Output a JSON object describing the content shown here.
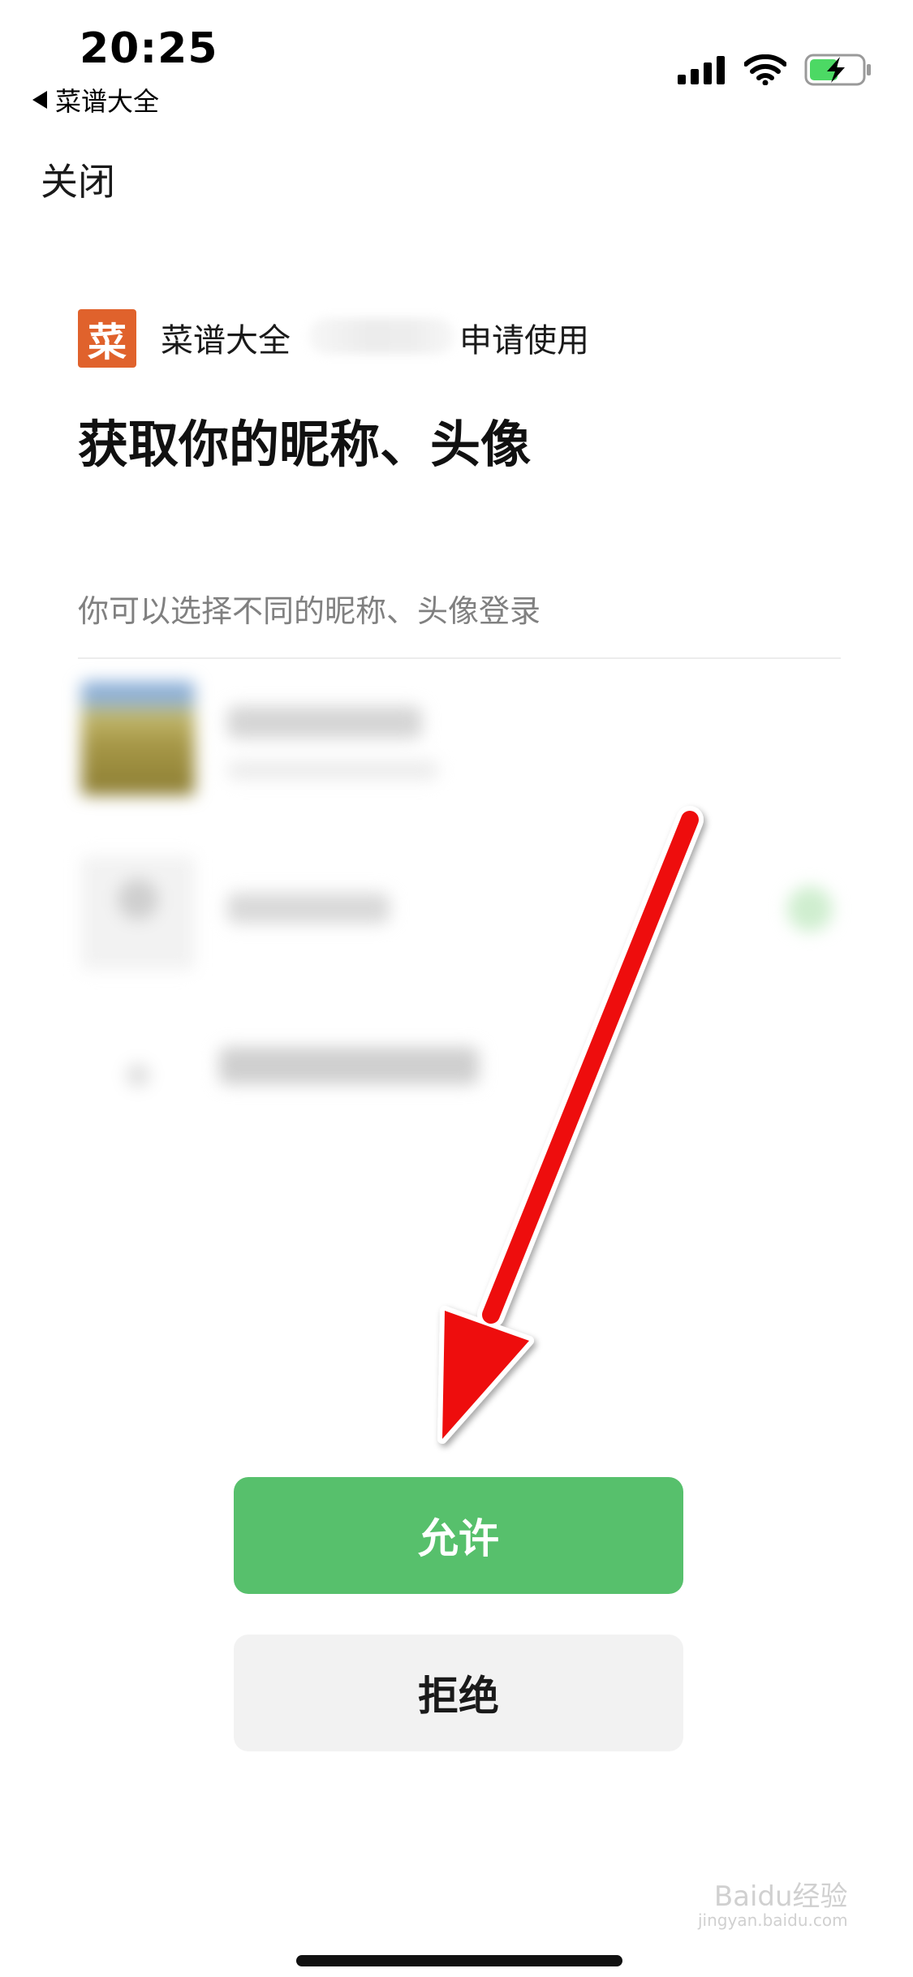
{
  "status_bar": {
    "time": "20:25",
    "back_app": "菜谱大全",
    "icons": [
      "cellular-signal-icon",
      "wifi-icon",
      "battery-charging-icon"
    ]
  },
  "nav": {
    "close_label": "关闭"
  },
  "authorization": {
    "app_logo_char": "菜",
    "app_name": "菜谱大全",
    "request_label": "申请使用",
    "title": "获取你的昵称、头像",
    "hint": "你可以选择不同的昵称、头像登录",
    "allow_label": "允许",
    "deny_label": "拒绝"
  },
  "watermark": {
    "brand": "Baidu经验",
    "url": "jingyan.baidu.com"
  },
  "colors": {
    "accent_green": "#57c06c",
    "logo_orange": "#e0622c",
    "arrow_red": "#ee1111",
    "deny_bg": "#f2f2f2"
  }
}
